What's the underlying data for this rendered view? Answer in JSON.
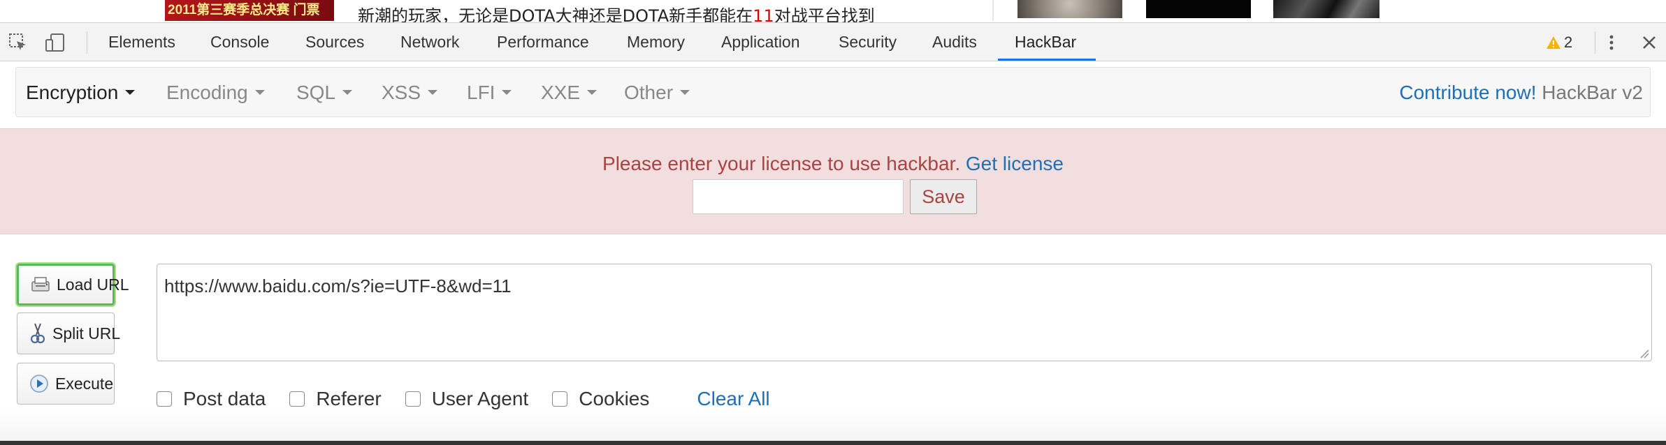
{
  "page": {
    "banner_text": "第三赛季总决赛 门票",
    "banner_year": "2011",
    "headline_before": "新潮的玩家，无论是DOTA大神还是DOTA新手都能在",
    "headline_highlight": "11",
    "headline_after": "对战平台找到"
  },
  "devtools": {
    "tabs": [
      "Elements",
      "Console",
      "Sources",
      "Network",
      "Performance",
      "Memory",
      "Application",
      "Security",
      "Audits",
      "HackBar"
    ],
    "active_tab": "HackBar",
    "warning_count": "2",
    "accent_color": "#1a73e8"
  },
  "hackbar": {
    "menus": [
      "Encryption",
      "Encoding",
      "SQL",
      "XSS",
      "LFI",
      "XXE",
      "Other"
    ],
    "contribute_link": "Contribute now!",
    "version_label": "HackBar v2",
    "alert": {
      "message": "Please enter your license to use hackbar.",
      "link": "Get license",
      "input_value": "",
      "save_label": "Save"
    },
    "actions": {
      "load_url": "Load URL",
      "split_url": "Split URL",
      "execute": "Execute"
    },
    "url_value": "https://www.baidu.com/s?ie=UTF-8&wd=11",
    "options": {
      "post_data": "Post data",
      "referer": "Referer",
      "user_agent": "User Agent",
      "cookies": "Cookies",
      "clear_all": "Clear All"
    }
  }
}
